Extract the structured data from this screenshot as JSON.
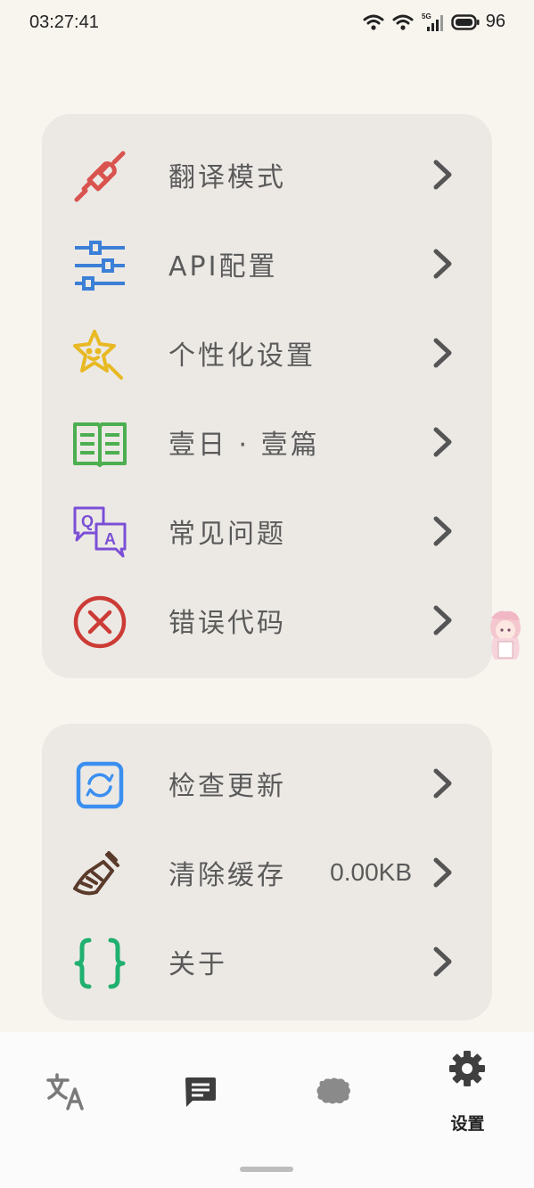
{
  "status_bar": {
    "time": "03:27:41",
    "battery": "96",
    "network": "5G"
  },
  "settings_group_1": [
    {
      "label": "翻译模式",
      "icon": "plug-icon",
      "color": "#d9534f"
    },
    {
      "label": "API配置",
      "icon": "sliders-icon",
      "color": "#3b7fd6"
    },
    {
      "label": "个性化设置",
      "icon": "star-magic-icon",
      "color": "#e8b923"
    },
    {
      "label": "壹日 · 壹篇",
      "icon": "book-icon",
      "color": "#4caf50"
    },
    {
      "label": "常见问题",
      "icon": "qa-icon",
      "color": "#7b4fd6"
    },
    {
      "label": "错误代码",
      "icon": "error-circle-icon",
      "color": "#cc3b35"
    }
  ],
  "settings_group_2": [
    {
      "label": "检查更新",
      "icon": "refresh-icon",
      "color": "#3b8ff0"
    },
    {
      "label": "清除缓存",
      "icon": "broom-icon",
      "color": "#5a3a2a",
      "value": "0.00KB"
    },
    {
      "label": "关于",
      "icon": "braces-icon",
      "color": "#20b070"
    }
  ],
  "bottom_nav": {
    "items": [
      {
        "icon": "translate-icon",
        "label": ""
      },
      {
        "icon": "chat-icon",
        "label": ""
      },
      {
        "icon": "blob-icon",
        "label": ""
      },
      {
        "icon": "gear-icon",
        "label": "设置",
        "active": true
      }
    ]
  },
  "colors": {
    "background": "#f8f4ee",
    "card": "#ece9e5",
    "chevron": "#555555",
    "nav_bg": "#fbfbfb"
  }
}
